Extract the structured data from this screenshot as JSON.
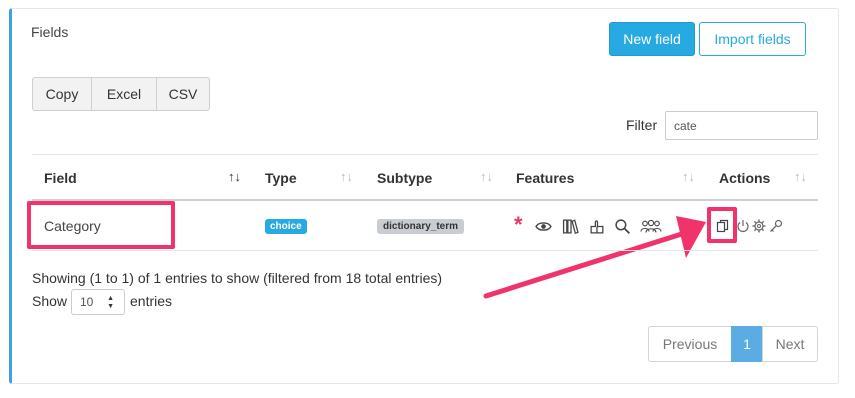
{
  "panel": {
    "title": "Fields"
  },
  "toolbar": {
    "new_field": "New field",
    "import_fields": "Import fields"
  },
  "export": {
    "copy": "Copy",
    "excel": "Excel",
    "csv": "CSV"
  },
  "filter": {
    "label": "Filter",
    "value": "cate"
  },
  "table": {
    "headers": [
      "Field",
      "Type",
      "Subtype",
      "Features",
      "Actions"
    ],
    "rows": [
      {
        "field": "Category",
        "type": "choice",
        "subtype": "dictionary_term",
        "features": [
          "required-asterisk-icon",
          "eye-icon",
          "books-icon",
          "hand-icon",
          "search-icon",
          "users-icon"
        ],
        "actions": [
          "copy-icon",
          "power-icon",
          "gear-icon",
          "key-icon"
        ]
      }
    ]
  },
  "info": "Showing (1 to 1) of 1 entries to show (filtered from 18 total entries)",
  "length": {
    "show": "Show",
    "value": "10",
    "entries": "entries"
  },
  "pagination": {
    "previous": "Previous",
    "current": "1",
    "next": "Next"
  },
  "colors": {
    "accent": "#27a9e1",
    "highlight": "#f0336b"
  }
}
